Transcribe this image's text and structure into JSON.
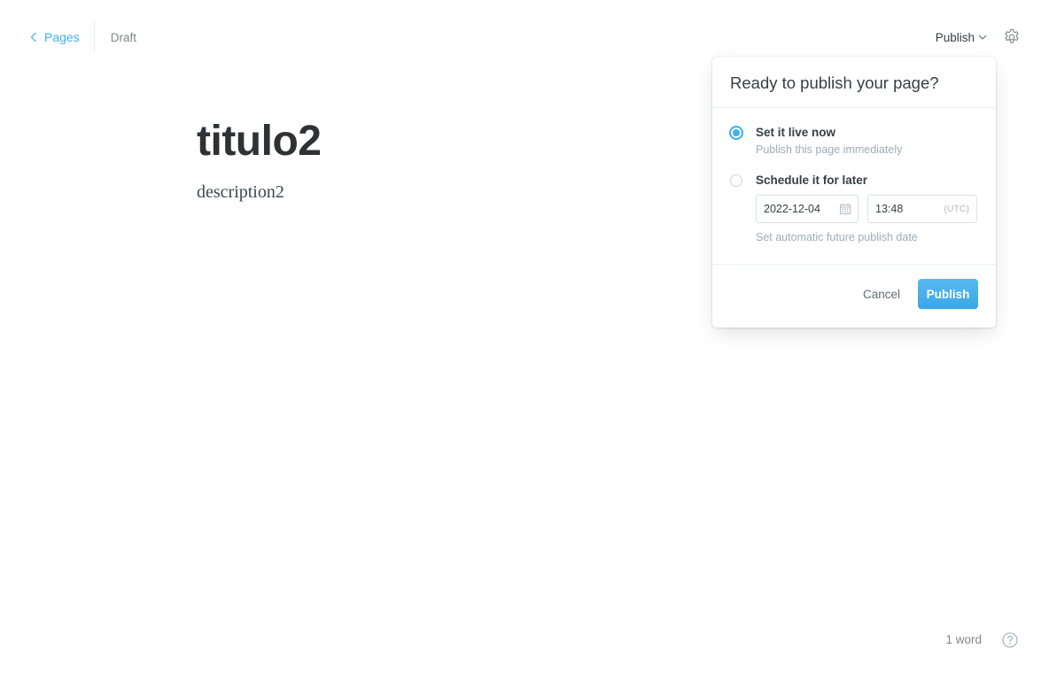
{
  "nav": {
    "back_label": "Pages",
    "status": "Draft"
  },
  "header": {
    "publish_label": "Publish",
    "settings_icon": "gear-icon"
  },
  "editor": {
    "title": "titulo2",
    "body": "description2"
  },
  "publish_menu": {
    "title": "Ready to publish your page?",
    "option_now": {
      "label": "Set it live now",
      "description": "Publish this page immediately",
      "selected": true
    },
    "option_later": {
      "label": "Schedule it for later",
      "date": "2022-12-04",
      "time": "13:48",
      "timezone": "(UTC)",
      "description": "Set automatic future publish date",
      "selected": false
    },
    "cancel_label": "Cancel",
    "publish_label": "Publish"
  },
  "footer": {
    "word_count": "1 word",
    "help_icon": "question-circle-icon"
  },
  "colors": {
    "accent": "#3eb0ef",
    "text_dark": "#343f44",
    "muted": "#9baeb8"
  }
}
